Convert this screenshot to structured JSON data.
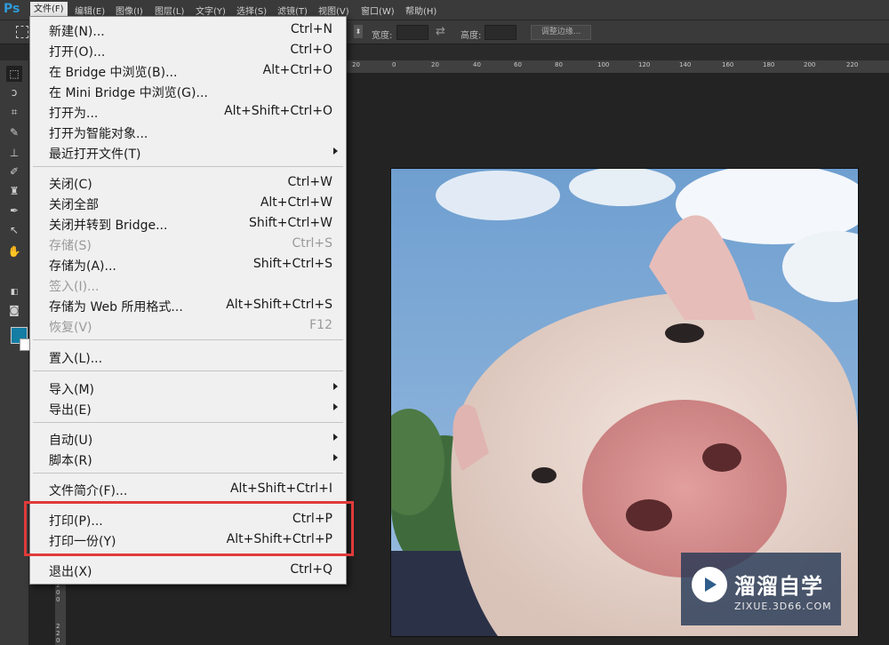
{
  "app": {
    "logo": "Ps"
  },
  "menubar": {
    "items": [
      "文件(F)",
      "编辑(E)",
      "图像(I)",
      "图层(L)",
      "文字(Y)",
      "选择(S)",
      "滤镜(T)",
      "视图(V)",
      "窗口(W)",
      "帮助(H)"
    ]
  },
  "options": {
    "width_label": "宽度:",
    "height_label": "高度:",
    "refine_button": "调整边缘..."
  },
  "ruler": {
    "h_ticks": [
      "20",
      "0",
      "20",
      "40",
      "60",
      "80",
      "100",
      "120",
      "140",
      "160",
      "180",
      "200",
      "220"
    ],
    "v_ticks": [
      "2",
      "0",
      "0",
      "2",
      "2",
      "0"
    ]
  },
  "file_menu": {
    "new": {
      "label": "新建(N)...",
      "shortcut": "Ctrl+N"
    },
    "open": {
      "label": "打开(O)...",
      "shortcut": "Ctrl+O"
    },
    "browse_bridge": {
      "label": "在 Bridge 中浏览(B)...",
      "shortcut": "Alt+Ctrl+O"
    },
    "browse_mini_bridge": {
      "label": "在 Mini Bridge 中浏览(G)...",
      "shortcut": ""
    },
    "open_as": {
      "label": "打开为...",
      "shortcut": "Alt+Shift+Ctrl+O"
    },
    "open_smart": {
      "label": "打开为智能对象...",
      "shortcut": ""
    },
    "recent": {
      "label": "最近打开文件(T)",
      "shortcut": ""
    },
    "close": {
      "label": "关闭(C)",
      "shortcut": "Ctrl+W"
    },
    "close_all": {
      "label": "关闭全部",
      "shortcut": "Alt+Ctrl+W"
    },
    "close_goto_bridge": {
      "label": "关闭并转到 Bridge...",
      "shortcut": "Shift+Ctrl+W"
    },
    "save": {
      "label": "存储(S)",
      "shortcut": "Ctrl+S"
    },
    "save_as": {
      "label": "存储为(A)...",
      "shortcut": "Shift+Ctrl+S"
    },
    "check_in": {
      "label": "签入(I)...",
      "shortcut": ""
    },
    "save_web": {
      "label": "存储为 Web 所用格式...",
      "shortcut": "Alt+Shift+Ctrl+S"
    },
    "revert": {
      "label": "恢复(V)",
      "shortcut": "F12"
    },
    "place": {
      "label": "置入(L)...",
      "shortcut": ""
    },
    "import": {
      "label": "导入(M)",
      "shortcut": ""
    },
    "export": {
      "label": "导出(E)",
      "shortcut": ""
    },
    "automate": {
      "label": "自动(U)",
      "shortcut": ""
    },
    "scripts": {
      "label": "脚本(R)",
      "shortcut": ""
    },
    "file_info": {
      "label": "文件简介(F)...",
      "shortcut": "Alt+Shift+Ctrl+I"
    },
    "print": {
      "label": "打印(P)...",
      "shortcut": "Ctrl+P"
    },
    "print_one": {
      "label": "打印一份(Y)",
      "shortcut": "Alt+Shift+Ctrl+P"
    },
    "exit": {
      "label": "退出(X)",
      "shortcut": "Ctrl+Q"
    }
  },
  "watermark": {
    "name": "溜溜自学",
    "url": "ZIXUE.3D66.COM"
  },
  "colors": {
    "foreground": "#137da3",
    "background": "#ffffff",
    "highlight": "#e03a3a"
  }
}
